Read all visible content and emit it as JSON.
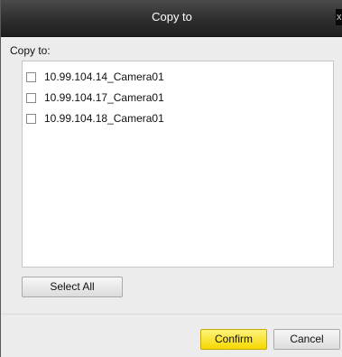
{
  "dialog": {
    "title": "Copy to",
    "close_glyph": "x",
    "copy_to_label": "Copy to:",
    "items": [
      {
        "label": "10.99.104.14_Camera01",
        "checked": false
      },
      {
        "label": "10.99.104.17_Camera01",
        "checked": false
      },
      {
        "label": "10.99.104.18_Camera01",
        "checked": false
      }
    ],
    "select_all_label": "Select All",
    "confirm_label": "Confirm",
    "cancel_label": "Cancel"
  },
  "colors": {
    "titlebar": "#2e2e2e",
    "dialog_background": "#ececec",
    "confirm_button": "#f5d800"
  }
}
